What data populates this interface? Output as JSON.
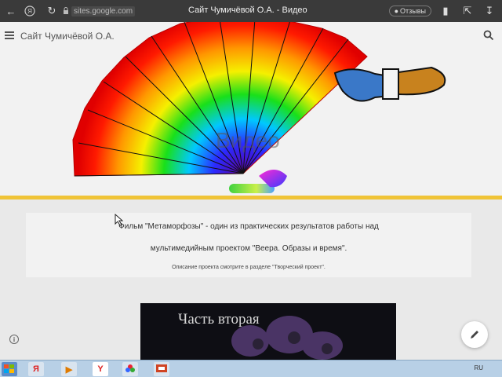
{
  "browser": {
    "url": "sites.google.com",
    "tab_title": "Сайт Чумичёвой О.А. - Видео",
    "reviews_label": "Отзывы"
  },
  "site": {
    "title": "Сайт Чумичёвой О.А.",
    "page_heading": "Видео"
  },
  "content": {
    "line1": "Фильм \"Метаморфозы\" - один из практических результатов работы над",
    "line2": "мультимедийным проектом \"Веера. Образы и время\".",
    "line3": "Описание проекта смотрите в разделе \"Творческий проект\"."
  },
  "video": {
    "overlay_text": "Часть вторая"
  },
  "taskbar": {
    "language": "RU",
    "items": [
      "start-icon",
      "folder-icon",
      "yandex-icon",
      "media-player-icon",
      "yandex-browser-icon",
      "photos-icon",
      "presentation-icon"
    ]
  },
  "colors": {
    "accent_line": "#f0c437",
    "browser_bar": "#3a3a3a",
    "taskbar": "#b8d0e6"
  }
}
